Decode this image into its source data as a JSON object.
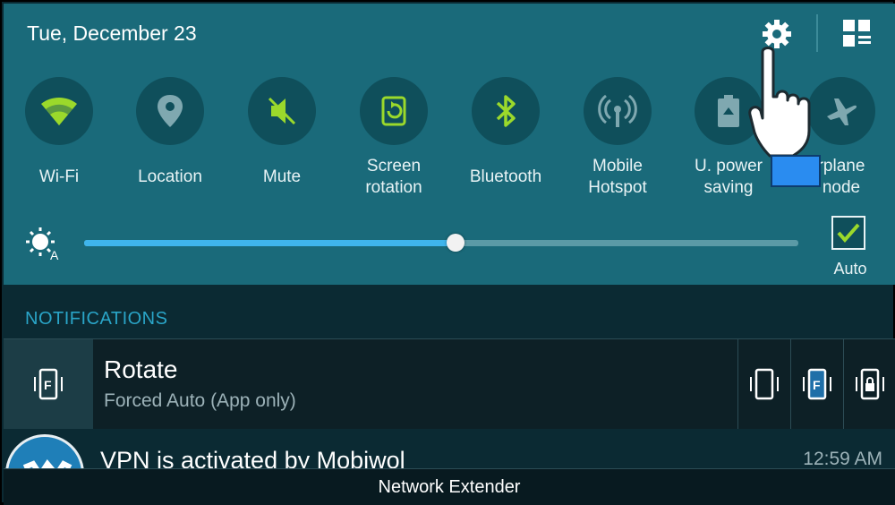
{
  "header": {
    "date": "Tue, December 23",
    "settings_icon": "gear-icon",
    "quick_settings_grid_icon": "grid-edit-icon"
  },
  "tiles": [
    {
      "label": "Wi-Fi",
      "icon": "wifi-icon",
      "active": true
    },
    {
      "label": "Location",
      "icon": "location-pin-icon",
      "active": false
    },
    {
      "label": "Mute",
      "icon": "mute-icon",
      "active": true
    },
    {
      "label_line1": "Screen",
      "label_line2": "rotation",
      "icon": "screen-rotation-icon",
      "active": true
    },
    {
      "label": "Bluetooth",
      "icon": "bluetooth-icon",
      "active": true
    },
    {
      "label_line1": "Mobile",
      "label_line2": "Hotspot",
      "icon": "hotspot-icon",
      "active": false
    },
    {
      "label_line1": "U. power",
      "label_line2": "saving",
      "icon": "power-saving-icon",
      "active": false
    },
    {
      "label_line1": "rplane",
      "label_line2": "node",
      "icon": "airplane-icon",
      "active": false
    }
  ],
  "brightness": {
    "icon": "auto-brightness-icon",
    "level": 0.52,
    "auto_label": "Auto",
    "auto_checked": true
  },
  "notifications": {
    "header": "NOTIFICATIONS",
    "rotate": {
      "title": "Rotate",
      "subtitle": "Forced Auto (App only)",
      "modes": [
        "portrait-icon",
        "forced-auto-icon",
        "rotation-lock-icon"
      ]
    },
    "vpn": {
      "title": "VPN is activated by Mobiwol",
      "time": "12:59 AM"
    }
  },
  "bottom_bar": {
    "label": "Network Extender"
  },
  "colors": {
    "panel": "#1a6a7a",
    "tile_circle": "#0f4f5b",
    "accent_green": "#9bd92b",
    "slider_blue": "#3fb5ec",
    "notif_header": "#2aa5c8"
  }
}
